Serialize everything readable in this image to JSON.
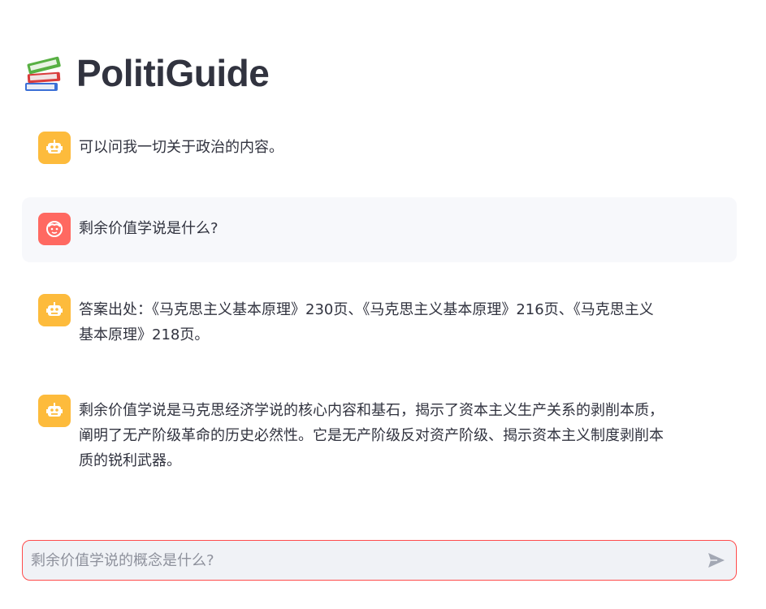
{
  "app": {
    "title": "PolitiGuide",
    "logo_icon": "books-icon"
  },
  "messages": [
    {
      "role": "assistant",
      "avatar_icon": "robot-icon",
      "text": "可以问我一切关于政治的内容。"
    },
    {
      "role": "user",
      "avatar_icon": "user-face-icon",
      "text": "剩余价值学说是什么?"
    },
    {
      "role": "assistant",
      "avatar_icon": "robot-icon",
      "text": "答案出处：《马克思主义基本原理》230页、《马克思主义基本原理》216页、《马克思主义\n基本原理》218页。"
    },
    {
      "role": "assistant",
      "avatar_icon": "robot-icon",
      "text": "剩余价值学说是马克思经济学说的核心内容和基石，揭示了资本主义生产关系的剥削本质，\n阐明了无产阶级革命的历史必然性。它是无产阶级反对资产阶级、揭示资本主义制度剥削本\n质的锐利武器。"
    }
  ],
  "chat_input": {
    "placeholder": "剩余价值学说的概念是什么?",
    "value": "",
    "send_icon": "send-icon"
  },
  "colors": {
    "bot_avatar": "#fdbb3c",
    "user_avatar": "#ff6961",
    "user_bubble": "#f7f8fb",
    "input_border": "#ff4b4b",
    "input_bg": "#f0f2f6",
    "text": "#31333f"
  }
}
